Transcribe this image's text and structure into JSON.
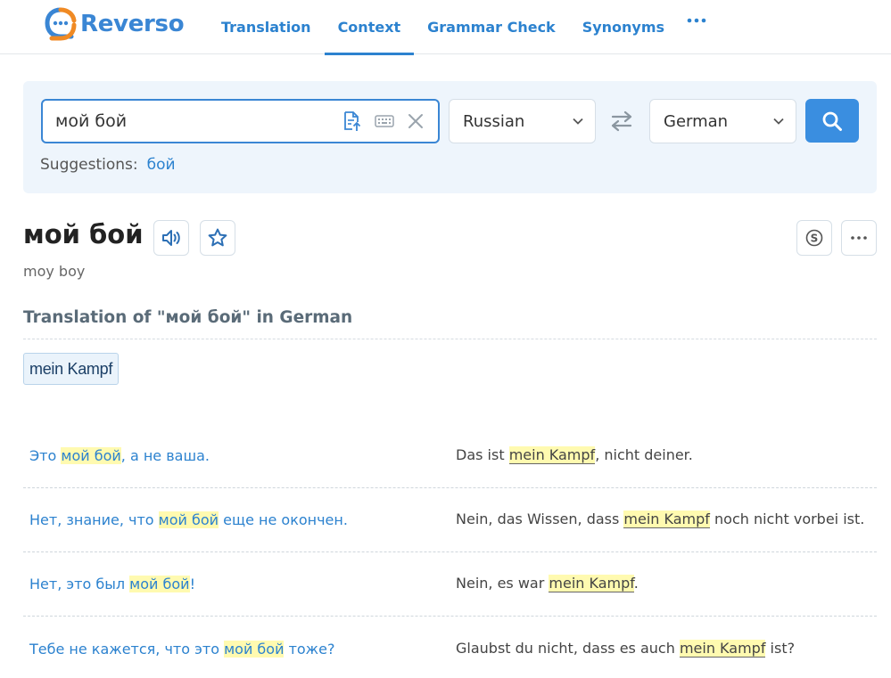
{
  "brand": {
    "name": "Reverso",
    "accent": "#3a86d4",
    "logo_orange": "#f08a24"
  },
  "nav": {
    "items": [
      {
        "label": "Translation",
        "active": false
      },
      {
        "label": "Context",
        "active": true
      },
      {
        "label": "Grammar Check",
        "active": false
      },
      {
        "label": "Synonyms",
        "active": false
      }
    ],
    "more_icon": "ellipsis-icon"
  },
  "search": {
    "value": "мой бой",
    "icons": [
      "upload-document-icon",
      "keyboard-icon",
      "close-icon"
    ],
    "source_lang": "Russian",
    "target_lang": "German",
    "swap_icon": "swap-icon",
    "search_icon": "magnifier-icon"
  },
  "suggestions": {
    "label": "Suggestions:",
    "items": [
      "бой"
    ]
  },
  "headword": {
    "text": "мой бой",
    "transliteration": "moy boy"
  },
  "translation_section": {
    "title": "Translation of \"мой бой\" in German",
    "chips": [
      "mein Kampf"
    ]
  },
  "examples": [
    {
      "src": {
        "before": "Это ",
        "hl": "мой бой",
        "after": ", а не ваша."
      },
      "trg": {
        "before": "Das ist ",
        "hl": "mein Kampf",
        "after": ", nicht deiner."
      }
    },
    {
      "src": {
        "before": "Нет, знание, что ",
        "hl": "мой бой",
        "after": " еще не окончен."
      },
      "trg": {
        "before": "Nein, das Wissen, dass ",
        "hl": "mein Kampf",
        "after": " noch nicht vorbei ist."
      }
    },
    {
      "src": {
        "before": "Нет, это был ",
        "hl": "мой бой",
        "after": "!"
      },
      "trg": {
        "before": "Nein, es war ",
        "hl": "mein Kampf",
        "after": "."
      }
    },
    {
      "src": {
        "before": "Тебе не кажется, что это ",
        "hl": "мой бой",
        "after": " тоже?"
      },
      "trg": {
        "before": "Glaubst du nicht, dass es auch ",
        "hl": "mein Kampf",
        "after": " ist?"
      }
    }
  ]
}
